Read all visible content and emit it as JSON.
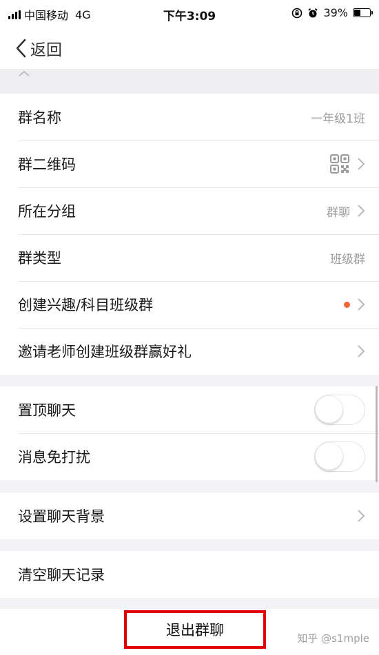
{
  "status_bar": {
    "carrier": "中国移动",
    "network": "4G",
    "time": "下午3:09",
    "battery_percent": "39%",
    "battery_level": 0.39,
    "icons": [
      "signal-icon",
      "orientation-lock-icon",
      "alarm-icon",
      "battery-icon"
    ]
  },
  "nav": {
    "back_label": "返回",
    "back_icon": "chevron-left-icon"
  },
  "collapse": {
    "icon": "chevron-up-icon"
  },
  "info_group": [
    {
      "label": "群名称",
      "value": "一年级1班",
      "chevron": false
    },
    {
      "label": "群二维码",
      "value": "",
      "icon": "qr-code-icon",
      "chevron": true
    },
    {
      "label": "所在分组",
      "value": "群聊",
      "chevron": true
    },
    {
      "label": "群类型",
      "value": "班级群",
      "chevron": false
    },
    {
      "label": "创建兴趣/科目班级群",
      "value": "",
      "badge_dot": true,
      "chevron": true
    },
    {
      "label": "邀请老师创建班级群赢好礼",
      "value": "",
      "chevron": true
    }
  ],
  "toggle_group": [
    {
      "label": "置顶聊天",
      "on": false
    },
    {
      "label": "消息免打扰",
      "on": false
    }
  ],
  "background_group": [
    {
      "label": "设置聊天背景",
      "chevron": true
    }
  ],
  "clear_group": [
    {
      "label": "清空聊天记录"
    }
  ],
  "exit_button": {
    "label": "退出群聊",
    "highlight_color": "#e00000"
  },
  "watermark": "知乎 @s1mple",
  "colors": {
    "accent_dot": "#f2663a",
    "page_bg": "#f3f3f5",
    "secondary_text": "#9a9a9a"
  }
}
